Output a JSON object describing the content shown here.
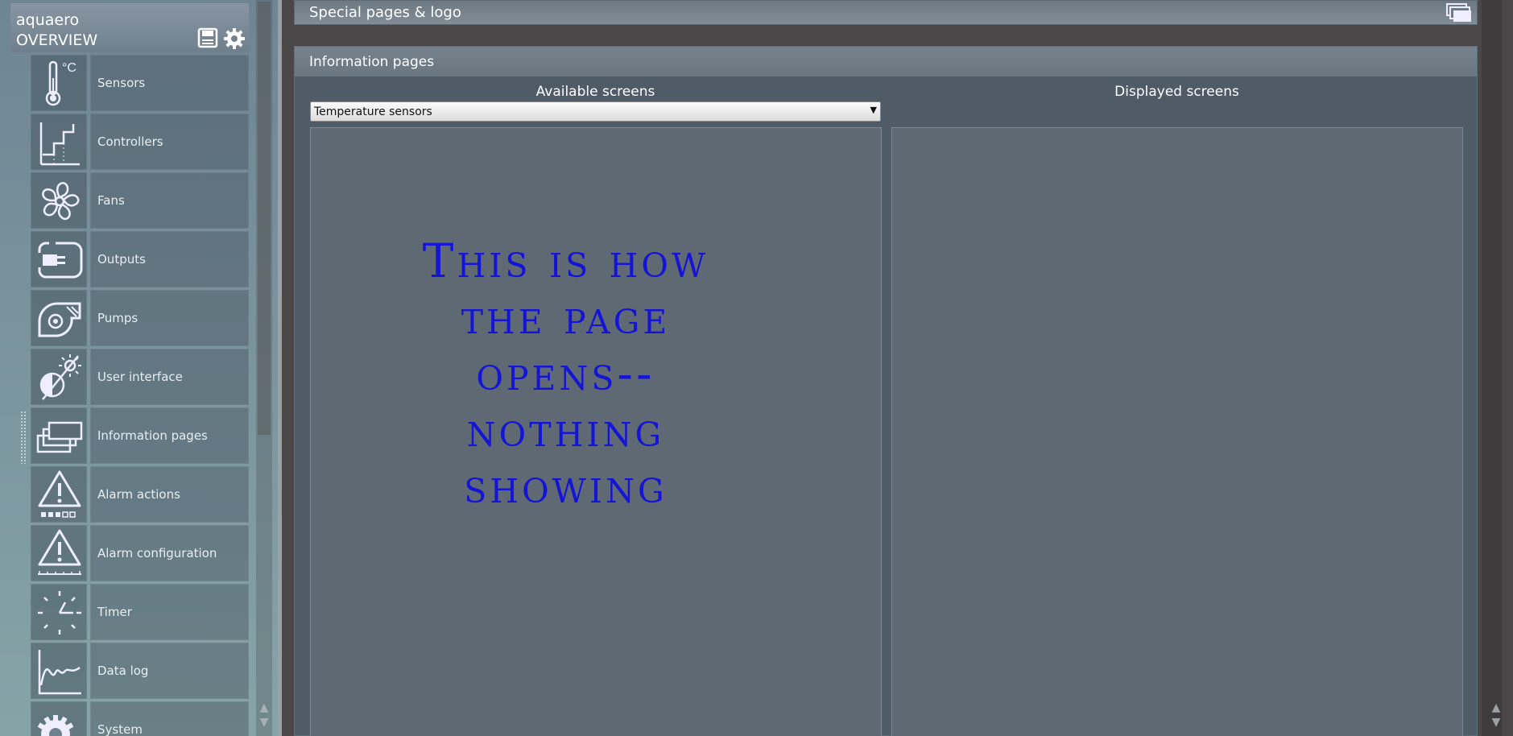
{
  "sidebar": {
    "app_name": "aquaero",
    "mode": "OVERVIEW",
    "items": [
      {
        "label": "Sensors",
        "icon": "thermometer-icon"
      },
      {
        "label": "Controllers",
        "icon": "controller-icon"
      },
      {
        "label": "Fans",
        "icon": "fan-icon"
      },
      {
        "label": "Outputs",
        "icon": "plug-icon"
      },
      {
        "label": "Pumps",
        "icon": "pump-icon"
      },
      {
        "label": "User interface",
        "icon": "brightness-icon"
      },
      {
        "label": "Information pages",
        "icon": "pages-icon"
      },
      {
        "label": "Alarm actions",
        "icon": "alarm-icon"
      },
      {
        "label": "Alarm configuration",
        "icon": "alarm-config-icon"
      },
      {
        "label": "Timer",
        "icon": "timer-icon"
      },
      {
        "label": "Data log",
        "icon": "chart-icon"
      },
      {
        "label": "System",
        "icon": "system-gear-icon"
      }
    ]
  },
  "main": {
    "special_panel_title": "Special pages & logo",
    "info_panel_title": "Information pages",
    "available_title": "Available screens",
    "displayed_title": "Displayed screens",
    "select_value": "Temperature sensors",
    "annotation": "This is how the page opens--nothing showing"
  }
}
